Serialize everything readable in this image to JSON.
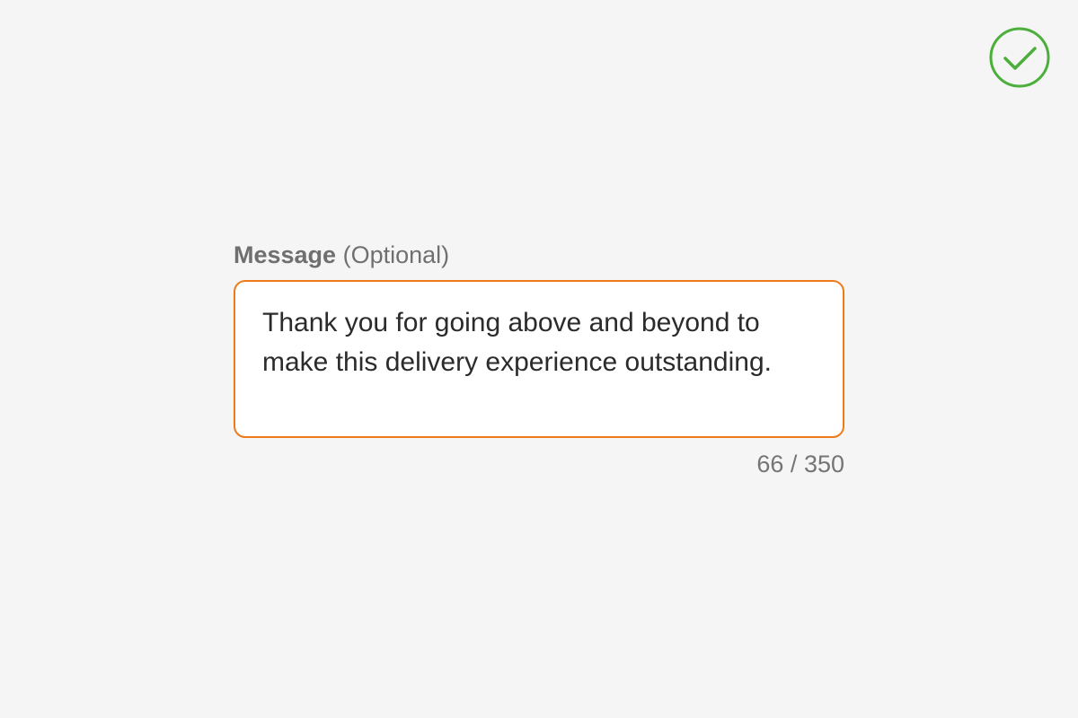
{
  "status": {
    "icon": "check-circle-icon",
    "color": "#4caf3c"
  },
  "field": {
    "label": "Message",
    "optional_label": "(Optional)",
    "value": "Thank you for going above and beyond to make this delivery experience outstanding.",
    "border_color": "#ef7a1a",
    "counter": {
      "current": "66",
      "separator": "/",
      "max": "350"
    }
  }
}
